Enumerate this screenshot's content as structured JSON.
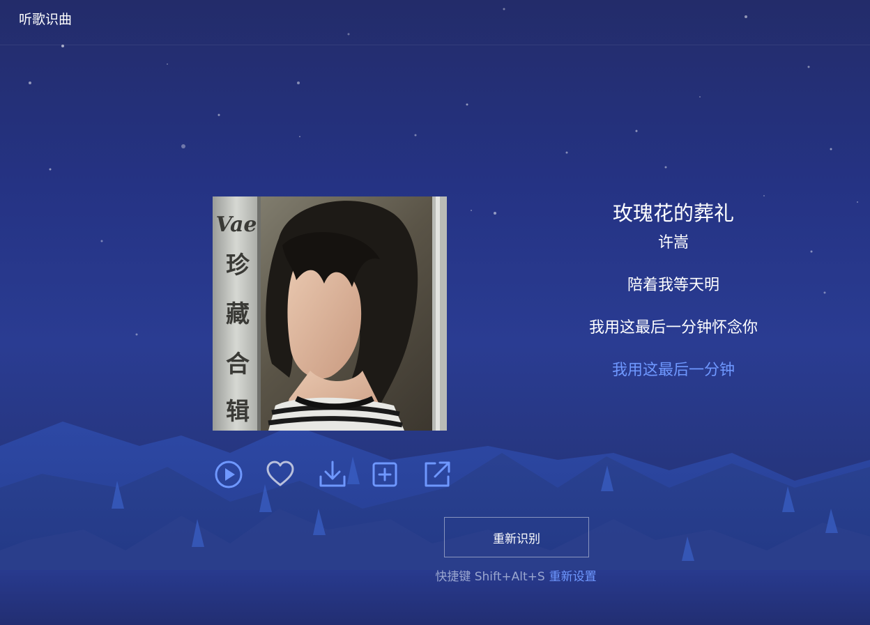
{
  "header": {
    "title": "听歌识曲"
  },
  "album": {
    "cover_text_latin": "Vae",
    "cover_text_cn": [
      "珍",
      "藏",
      "合",
      "辑"
    ]
  },
  "song": {
    "title": "玫瑰花的葬礼",
    "artist": "许嵩"
  },
  "lyrics": [
    {
      "text": "陪着我等天明",
      "active": false
    },
    {
      "text": "我用这最后一分钟怀念你",
      "active": false
    },
    {
      "text": "我用这最后一分钟",
      "active": true
    }
  ],
  "actions": [
    {
      "id": "play",
      "icon": "play-circle-icon"
    },
    {
      "id": "like",
      "icon": "heart-icon"
    },
    {
      "id": "download",
      "icon": "download-icon"
    },
    {
      "id": "add",
      "icon": "add-to-playlist-icon"
    },
    {
      "id": "share",
      "icon": "share-external-icon"
    }
  ],
  "buttons": {
    "reidentify_label": "重新识别"
  },
  "shortcut": {
    "text": "快捷键 Shift+Alt+S",
    "reset_label": "重新设置"
  },
  "colors": {
    "accent": "#6f98ff",
    "background": "#26357f",
    "icon": "#6f98ff",
    "heart": "#b9c0dc"
  }
}
